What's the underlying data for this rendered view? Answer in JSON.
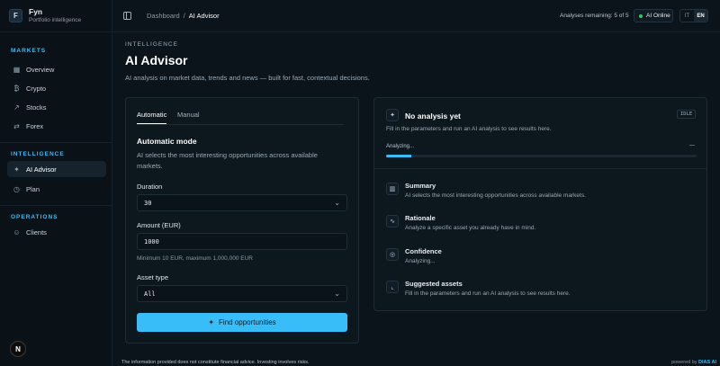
{
  "brand": {
    "logo": "F",
    "name": "Fyn",
    "subtitle": "Portfolio intelligence"
  },
  "sidebar": {
    "sections": [
      {
        "title": "MARKETS"
      },
      {
        "title": "INTELLIGENCE"
      },
      {
        "title": "OPERATIONS"
      }
    ],
    "items": [
      {
        "label": "Overview",
        "icon": "overview-icon",
        "glyph": "▦"
      },
      {
        "label": "Crypto",
        "icon": "bitcoin-icon",
        "glyph": "₿"
      },
      {
        "label": "Stocks",
        "icon": "trending-icon",
        "glyph": "↗"
      },
      {
        "label": "Forex",
        "icon": "exchange-icon",
        "glyph": "⇄"
      },
      {
        "label": "AI Advisor",
        "icon": "sparkle-icon",
        "glyph": "✦",
        "active": true
      },
      {
        "label": "Plan",
        "icon": "clock-icon",
        "glyph": "◷"
      },
      {
        "label": "Clients",
        "icon": "users-icon",
        "glyph": "☺"
      }
    ],
    "avatar": "N"
  },
  "topbar": {
    "breadcrumb_root": "Dashboard",
    "breadcrumb_sep": "/",
    "breadcrumb_current": "AI Advisor",
    "remaining": "Analyses remaining: 5 of 5",
    "ai_status": "AI Online",
    "lang_it": "IT",
    "lang_en": "EN"
  },
  "header": {
    "eyebrow": "INTELLIGENCE",
    "title": "AI Advisor",
    "subtitle": "AI analysis on market data, trends and news — built for fast, contextual decisions."
  },
  "form": {
    "tabs": [
      "Automatic",
      "Manual"
    ],
    "mode_title": "Automatic mode",
    "mode_desc": "AI selects the most interesting opportunities across available markets.",
    "duration_label": "Duration",
    "duration_value": "30",
    "amount_label": "Amount (EUR)",
    "amount_value": "1000",
    "amount_hint": "Minimum 10 EUR, maximum 1,000,000 EUR",
    "asset_label": "Asset type",
    "asset_value": "All",
    "cta": "Find opportunities"
  },
  "result": {
    "title": "No analysis yet",
    "badge": "IDLE",
    "desc": "Fill in the parameters and run an AI analysis to see results here.",
    "progress_label": "Analyzing...",
    "progress_value": "—",
    "progress_fraction": 0.08,
    "items": [
      {
        "title": "Summary",
        "desc": "AI selects the most interesting opportunities across available markets.",
        "icon": "chart-icon",
        "glyph": "▥"
      },
      {
        "title": "Rationale",
        "desc": "Analyze a specific asset you already have in mind.",
        "icon": "pulse-icon",
        "glyph": "∿"
      },
      {
        "title": "Confidence",
        "desc": "Analyzing...",
        "icon": "gauge-icon",
        "glyph": "◎"
      },
      {
        "title": "Suggested assets",
        "desc": "Fill in the parameters and run an AI analysis to see results here.",
        "icon": "line-chart-icon",
        "glyph": "⌞"
      }
    ]
  },
  "footer": {
    "disclaimer": "The information provided does not constitute financial advice. Investing involves risks.",
    "powered_prefix": "powered by",
    "powered_brand": "DIAS AI"
  },
  "colors": {
    "accent": "#38bdf8",
    "online": "#2ecc71",
    "background": "#0b141b"
  }
}
